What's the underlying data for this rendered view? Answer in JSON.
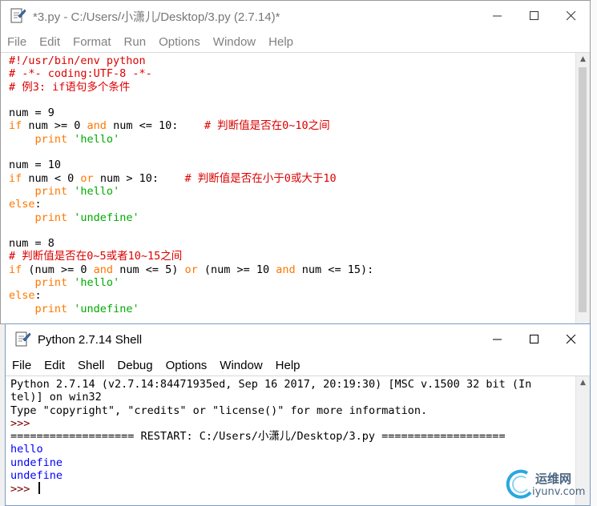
{
  "editor_window": {
    "title": "*3.py - C:/Users/小潇儿/Desktop/3.py (2.7.14)*",
    "menu": [
      "File",
      "Edit",
      "Format",
      "Run",
      "Options",
      "Window",
      "Help"
    ],
    "lines": [
      [
        {
          "t": "#!/usr/bin/env python",
          "c": "cm"
        }
      ],
      [
        {
          "t": "# -*- coding:UTF-8 -*-",
          "c": "cm"
        }
      ],
      [
        {
          "t": "# 例3: if语句多个条件",
          "c": "cm"
        }
      ],
      [],
      [
        {
          "t": "num = 9",
          "c": "def"
        }
      ],
      [
        {
          "t": "if",
          "c": "kw"
        },
        {
          "t": " num >= 0 ",
          "c": "def"
        },
        {
          "t": "and",
          "c": "kw"
        },
        {
          "t": " num <= 10:    ",
          "c": "def"
        },
        {
          "t": "# 判断值是否在0~10之间",
          "c": "cm"
        }
      ],
      [
        {
          "t": "    ",
          "c": "def"
        },
        {
          "t": "print",
          "c": "kw"
        },
        {
          "t": " ",
          "c": "def"
        },
        {
          "t": "'hello'",
          "c": "str"
        }
      ],
      [],
      [
        {
          "t": "num = 10",
          "c": "def"
        }
      ],
      [
        {
          "t": "if",
          "c": "kw"
        },
        {
          "t": " num < 0 ",
          "c": "def"
        },
        {
          "t": "or",
          "c": "kw"
        },
        {
          "t": " num > 10:    ",
          "c": "def"
        },
        {
          "t": "# 判断值是否在小于0或大于10",
          "c": "cm"
        }
      ],
      [
        {
          "t": "    ",
          "c": "def"
        },
        {
          "t": "print",
          "c": "kw"
        },
        {
          "t": " ",
          "c": "def"
        },
        {
          "t": "'hello'",
          "c": "str"
        }
      ],
      [
        {
          "t": "else",
          "c": "kw"
        },
        {
          "t": ":",
          "c": "def"
        }
      ],
      [
        {
          "t": "    ",
          "c": "def"
        },
        {
          "t": "print",
          "c": "kw"
        },
        {
          "t": " ",
          "c": "def"
        },
        {
          "t": "'undefine'",
          "c": "str"
        }
      ],
      [],
      [
        {
          "t": "num = 8",
          "c": "def"
        }
      ],
      [
        {
          "t": "# 判断值是否在0~5或者10~15之间",
          "c": "cm"
        }
      ],
      [
        {
          "t": "if",
          "c": "kw"
        },
        {
          "t": " (num >= 0 ",
          "c": "def"
        },
        {
          "t": "and",
          "c": "kw"
        },
        {
          "t": " num <= 5) ",
          "c": "def"
        },
        {
          "t": "or",
          "c": "kw"
        },
        {
          "t": " (num >= 10 ",
          "c": "def"
        },
        {
          "t": "and",
          "c": "kw"
        },
        {
          "t": " num <= 15):",
          "c": "def"
        }
      ],
      [
        {
          "t": "    ",
          "c": "def"
        },
        {
          "t": "print",
          "c": "kw"
        },
        {
          "t": " ",
          "c": "def"
        },
        {
          "t": "'hello'",
          "c": "str"
        }
      ],
      [
        {
          "t": "else",
          "c": "kw"
        },
        {
          "t": ":",
          "c": "def"
        }
      ],
      [
        {
          "t": "    ",
          "c": "def"
        },
        {
          "t": "print",
          "c": "kw"
        },
        {
          "t": " ",
          "c": "def"
        },
        {
          "t": "'undefine'",
          "c": "str"
        }
      ]
    ]
  },
  "shell_window": {
    "title": "Python 2.7.14 Shell",
    "menu": [
      "File",
      "Edit",
      "Shell",
      "Debug",
      "Options",
      "Window",
      "Help"
    ],
    "lines": [
      [
        {
          "t": "Python 2.7.14 (v2.7.14:84471935ed, Sep 16 2017, 20:19:30) [MSC v.1500 32 bit (In",
          "c": "def"
        }
      ],
      [
        {
          "t": "tel)] on win32",
          "c": "def"
        }
      ],
      [
        {
          "t": "Type \"copyright\", \"credits\" or \"license()\" for more information.",
          "c": "def"
        }
      ],
      [
        {
          "t": ">>> ",
          "c": "prompt"
        }
      ],
      [
        {
          "t": "=================== RESTART: C:/Users/小潇儿/Desktop/3.py ===================",
          "c": "def"
        }
      ],
      [
        {
          "t": "hello",
          "c": "out"
        }
      ],
      [
        {
          "t": "undefine",
          "c": "out"
        }
      ],
      [
        {
          "t": "undefine",
          "c": "out"
        }
      ],
      [
        {
          "t": ">>> ",
          "c": "prompt"
        }
      ]
    ]
  },
  "watermark": {
    "line1": "运维网",
    "line2": "iyunv.com"
  },
  "colors": {
    "keyword": "#ff7700",
    "string": "#00aa00",
    "comment": "#dd0000",
    "output": "#0000ff",
    "prompt": "#770000"
  },
  "icons": {
    "minimize": "minimize-icon",
    "maximize": "maximize-icon",
    "close": "close-icon",
    "app": "python-file-icon"
  }
}
